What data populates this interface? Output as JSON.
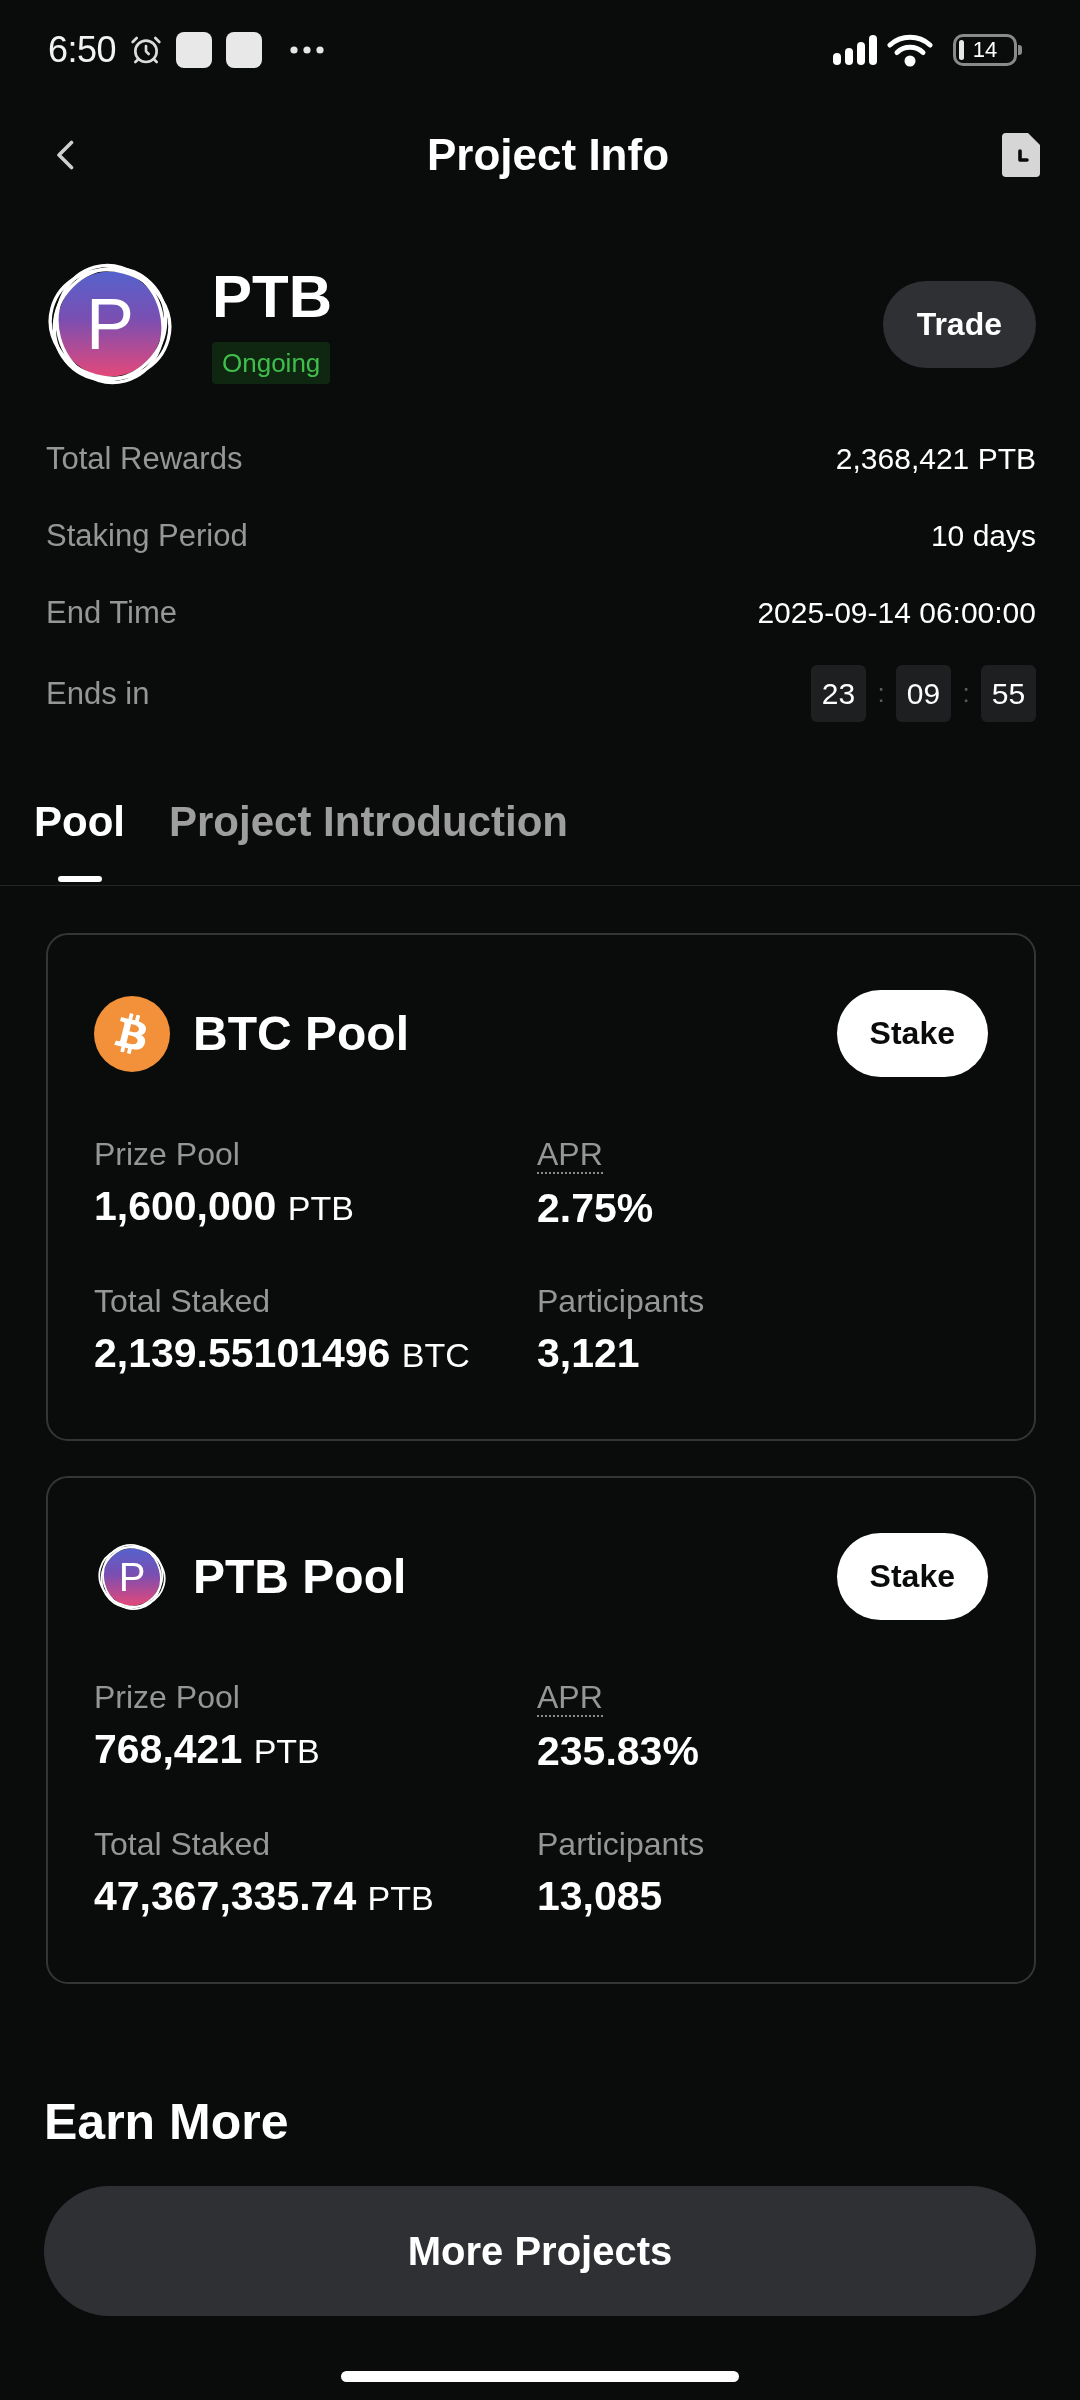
{
  "status_bar": {
    "time": "6:50",
    "battery": "14"
  },
  "header": {
    "title": "Project Info"
  },
  "project": {
    "logo_text": "P",
    "name": "PTB",
    "status": "Ongoing",
    "trade_button": "Trade"
  },
  "info_rows": [
    {
      "kind": "text",
      "label": "Total Rewards",
      "value": "2,368,421 PTB"
    },
    {
      "kind": "text",
      "label": "Staking Period",
      "value": "10 days"
    },
    {
      "kind": "text",
      "label": "End Time",
      "value": "2025-09-14 06:00:00"
    },
    {
      "kind": "countdown",
      "label": "Ends in",
      "parts": [
        {
          "kind": "digits",
          "text": "23"
        },
        {
          "kind": "separator",
          "text": ":"
        },
        {
          "kind": "digits",
          "text": "09"
        },
        {
          "kind": "separator",
          "text": ":"
        },
        {
          "kind": "digits",
          "text": "55"
        }
      ]
    }
  ],
  "tabs": [
    {
      "label": "Pool",
      "selected": true
    },
    {
      "label": "Project Introduction",
      "selected": false
    }
  ],
  "pools": [
    {
      "kind": "btc",
      "name": "BTC Pool",
      "stake_button": "Stake",
      "stats": [
        {
          "label": "Prize Pool",
          "value": "1,600,000",
          "unit": "PTB",
          "tooltip": false
        },
        {
          "label": "APR",
          "value": "2.75%",
          "tooltip": true
        },
        {
          "label": "Total Staked",
          "value": "2,139.55101496",
          "unit": "BTC",
          "tooltip": false
        },
        {
          "label": "Participants",
          "value": "3,121",
          "tooltip": false
        }
      ]
    },
    {
      "kind": "ptb",
      "icon_text": "P",
      "name": "PTB Pool",
      "stake_button": "Stake",
      "stats": [
        {
          "label": "Prize Pool",
          "value": "768,421",
          "unit": "PTB",
          "tooltip": false
        },
        {
          "label": "APR",
          "value": "235.83%",
          "tooltip": true
        },
        {
          "label": "Total Staked",
          "value": "47,367,335.74",
          "unit": "PTB",
          "tooltip": false
        },
        {
          "label": "Participants",
          "value": "13,085",
          "tooltip": false
        }
      ]
    }
  ],
  "earn_more": {
    "title": "Earn More",
    "button": "More Projects"
  }
}
